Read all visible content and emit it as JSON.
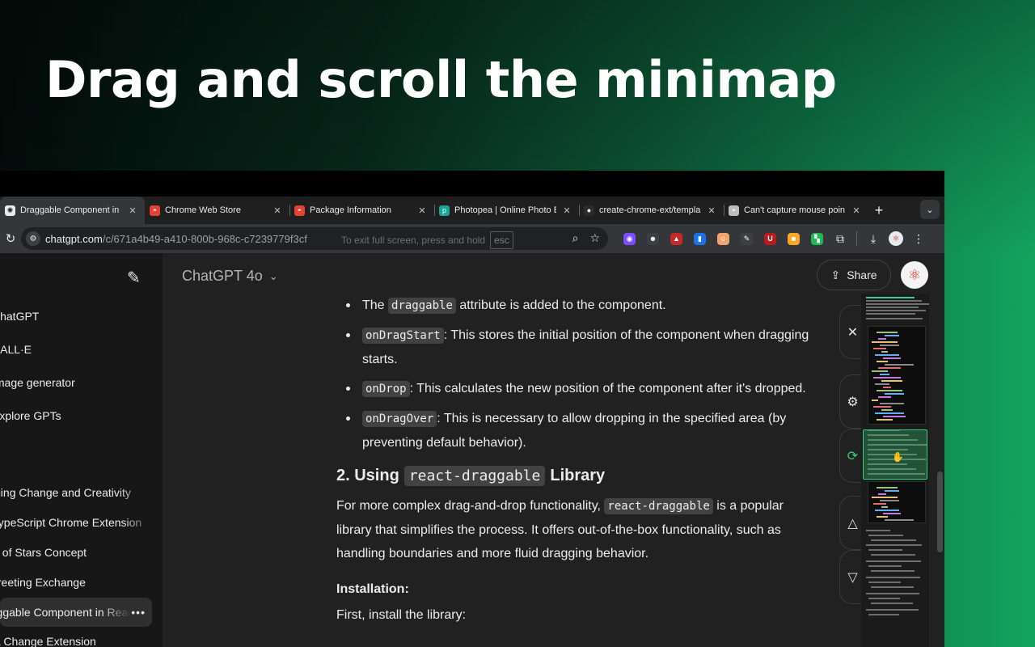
{
  "headline": "Drag and scroll the minimap",
  "browser": {
    "tabs": [
      {
        "title": "Draggable Component in R",
        "favicon": "chatgpt-icon",
        "color": "#e8eaed",
        "active": true
      },
      {
        "title": "Chrome Web Store",
        "favicon": "rainbow-icon",
        "color": "#e34234",
        "active": false
      },
      {
        "title": "Package Information",
        "favicon": "rainbow-icon",
        "color": "#e34234",
        "active": false
      },
      {
        "title": "Photopea | Online Photo E",
        "favicon": "photopea-icon",
        "color": "#18a497",
        "active": false
      },
      {
        "title": "create-chrome-ext/templa",
        "favicon": "github-icon",
        "color": "#2b2b2b",
        "active": false
      },
      {
        "title": "Can't capture mouse poin",
        "favicon": "apple-icon",
        "color": "#bdbdbd",
        "active": false
      }
    ],
    "url_host": "chatgpt.com",
    "url_path": "/c/671a4b49-a410-800b-968c-c7239779f3cf",
    "fullscreen_hint": "To exit full screen, press and hold",
    "fullscreen_key": "esc",
    "extensions": [
      {
        "name": "ext-purple-icon",
        "color": "#7c4dff",
        "glyph": "◉"
      },
      {
        "name": "ext-chat-icon",
        "color": "#3c4043",
        "glyph": "☻"
      },
      {
        "name": "ext-red-icon",
        "color": "#c62828",
        "glyph": "▲"
      },
      {
        "name": "ext-blue-icon",
        "color": "#1a73e8",
        "glyph": "▮"
      },
      {
        "name": "ext-face-icon",
        "color": "#f0a36b",
        "glyph": "☺"
      },
      {
        "name": "ext-pen-icon",
        "color": "#3c4043",
        "glyph": "✎"
      },
      {
        "name": "ext-ublock-icon",
        "color": "#b71c1c",
        "glyph": "U"
      },
      {
        "name": "ext-yellow-icon",
        "color": "#f9a825",
        "glyph": "■"
      },
      {
        "name": "ext-map-icon",
        "color": "#1db954",
        "glyph": "▚"
      }
    ]
  },
  "sidebar": {
    "items": [
      {
        "label": "ChatGPT",
        "name": "sidebar-item-chatgpt"
      },
      {
        "label": "DALL·E",
        "name": "sidebar-item-dalle"
      },
      {
        "label": "Image generator",
        "name": "sidebar-item-image-generator"
      },
      {
        "label": "Explore GPTs",
        "name": "sidebar-item-explore-gpts"
      }
    ],
    "history": [
      "Balancing Change and Creativity",
      "TypeScript Chrome Extension",
      "Sea of Stars Concept",
      "Greeting Exchange",
      "Draggable Component in React",
      "URL Change Extension"
    ]
  },
  "main": {
    "model": "ChatGPT 4o",
    "share_label": "Share",
    "bullets": [
      {
        "pre": "The ",
        "code": "draggable",
        "post": " attribute is added to the component."
      },
      {
        "pre": "",
        "code": "onDragStart",
        "post": ": This stores the initial position of the component when dragging starts."
      },
      {
        "pre": "",
        "code": "onDrop",
        "post": ": This calculates the new position of the component after it's dropped."
      },
      {
        "pre": "",
        "code": "onDragOver",
        "post": ": This is necessary to allow dropping in the specified area (by preventing default behavior)."
      }
    ],
    "h2_pre": "2. Using",
    "h2_code": "react-draggable",
    "h2_post": "Library",
    "para_pre": "For more complex drag-and-drop functionality, ",
    "para_code": "react-draggable",
    "para_post": " is a popular library that simplifies the process. It offers out-of-the-box functionality, such as handling boundaries and more fluid dragging behavior.",
    "install_heading": "Installation:",
    "install_text": "First, install the library:"
  }
}
